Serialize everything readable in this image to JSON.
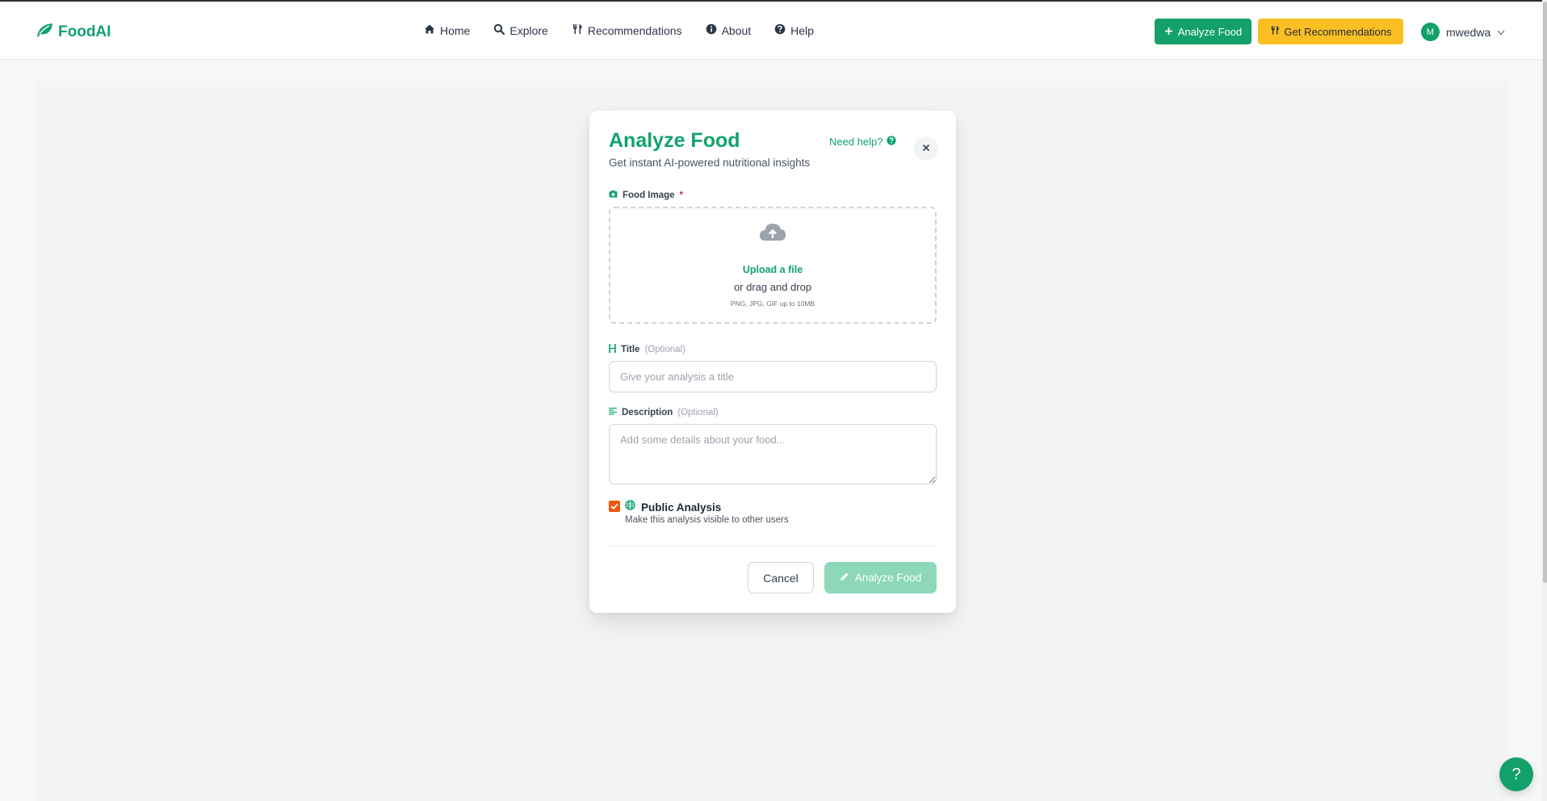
{
  "brand": {
    "name": "FoodAI",
    "icon": "leaf-icon",
    "color": "#12a36d"
  },
  "nav": {
    "links": [
      {
        "label": "Home",
        "icon": "home-icon"
      },
      {
        "label": "Explore",
        "icon": "search-icon"
      },
      {
        "label": "Recommendations",
        "icon": "utensils-icon"
      },
      {
        "label": "About",
        "icon": "info-icon"
      },
      {
        "label": "Help",
        "icon": "question-icon"
      }
    ],
    "analyze_button": {
      "label": "Analyze Food",
      "icon": "plus-icon",
      "color": "#13a06a"
    },
    "recommendations_button": {
      "label": "Get Recommendations",
      "icon": "utensils-icon",
      "color": "#fbbf24"
    },
    "user": {
      "initial": "M",
      "name": "mwedwa",
      "icon": "chevron-down-icon"
    }
  },
  "modal": {
    "title": "Analyze Food",
    "subtitle": "Get instant AI-powered nutritional insights",
    "help_link": "Need help?",
    "close_icon": "close-icon",
    "image_field": {
      "label": "Food Image",
      "required_marker": "*",
      "icon": "camera-icon",
      "upload_icon": "cloud-upload-icon",
      "upload_link": "Upload a file",
      "drag_text": "or drag and drop",
      "hint": "PNG, JPG, GIF up to 10MB"
    },
    "title_field": {
      "label": "Title",
      "optional_text": "(Optional)",
      "icon": "heading-icon",
      "placeholder": "Give your analysis a title",
      "value": ""
    },
    "description_field": {
      "label": "Description",
      "optional_text": "(Optional)",
      "icon": "align-left-icon",
      "placeholder": "Add some details about your food...",
      "value": ""
    },
    "public": {
      "checked": true,
      "label": "Public Analysis",
      "icon": "globe-icon",
      "help": "Make this analysis visible to other users"
    },
    "cancel_button": "Cancel",
    "submit_button": {
      "label": "Analyze Food",
      "icon": "pencil-icon",
      "disabled_color": "#8cd8b8"
    }
  },
  "floating_help": {
    "label": "?",
    "icon": "question-icon"
  }
}
